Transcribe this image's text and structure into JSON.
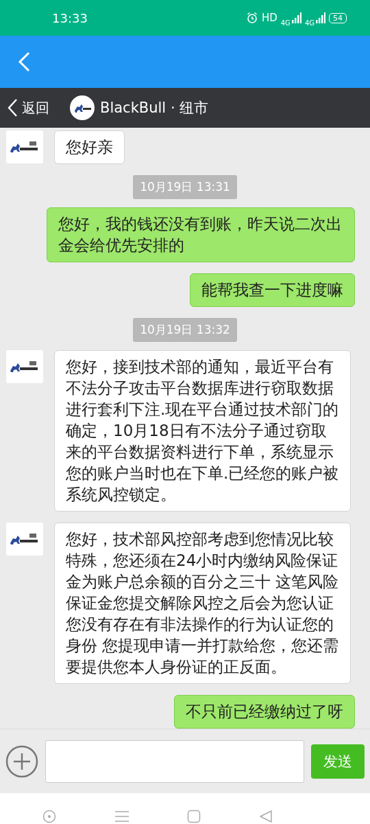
{
  "status_bar": {
    "time": "13:33",
    "hd": "HD",
    "network_1": "4G",
    "network_2": "4G",
    "battery": "54"
  },
  "chat_header": {
    "back_label": "返回",
    "title": "BlackBull · 纽市"
  },
  "messages": [
    {
      "kind": "received",
      "text": "您好亲"
    },
    {
      "kind": "time",
      "text": "10月19日 13:31"
    },
    {
      "kind": "sent",
      "text": "您好，我的钱还没有到账，昨天说二次出金会给优先安排的"
    },
    {
      "kind": "sent",
      "text": "能帮我查一下进度嘛"
    },
    {
      "kind": "time",
      "text": "10月19日 13:32"
    },
    {
      "kind": "received",
      "text": "您好，接到技术部的通知，最近平台有不法分子攻击平台数据库进行窃取数据进行套利下注.现在平台通过技术部门的确定，10月18日有不法分子通过窃取来的平台数据资料进行下单，系统显示您的账户当时也在下单.已经您的账户被系统风控锁定。"
    },
    {
      "kind": "received",
      "text": "您好，技术部风控部考虑到您情况比较特殊，您还须在24小时内缴纳风险保证金为账户总余额的百分之三十 这笔风险保证金您提交解除风控之后会为您认证您没有存在有非法操作的行为认证您的身份 您提现申请一并打款给您，您还需要提供您本人身份证的正反面。"
    },
    {
      "kind": "sent",
      "text": "不只前已经缴纳过了呀"
    }
  ],
  "composer": {
    "send_label": "发送"
  }
}
